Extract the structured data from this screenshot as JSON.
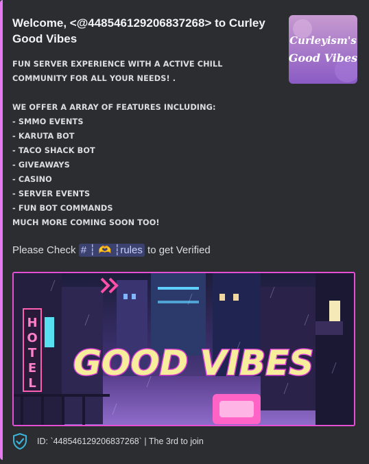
{
  "embed": {
    "accent_color": "#e57bef",
    "title": "Welcome, <@448546129206837268> to Curley Good Vibes",
    "description_lines": [
      "FUN SERVER EXPERIENCE WITH A ACTIVE CHILL",
      "COMMUNITY FOR ALL YOUR NEEDS! .",
      "",
      "WE OFFER A ARRAY OF FEATURES INCLUDING:",
      "- SMMO EVENTS",
      "- KARUTA BOT",
      "- TACO SHACK BOT",
      "- GIVEAWAYS",
      "- CASINO",
      "- SERVER EVENTS",
      "- FUN BOT COMMANDS",
      "MUCH MORE COMING SOON TOO!"
    ],
    "verify": {
      "prefix": "Please Check",
      "channel_hash": "#",
      "channel_sep": "┆",
      "channel_emoji": "🫶",
      "channel_name": "rules",
      "suffix": "to get Verified"
    },
    "thumbnail": {
      "text_line1": "Curleyism's",
      "text_line2": "Good Vibes"
    },
    "banner": {
      "headline": "GOOD VIBES",
      "sign_text": "HOTEL",
      "icon": "neon-city-image"
    },
    "footer": {
      "icon": "verified-shield-icon",
      "text": "ID: `448546129206837268` | The 3rd to join"
    }
  }
}
